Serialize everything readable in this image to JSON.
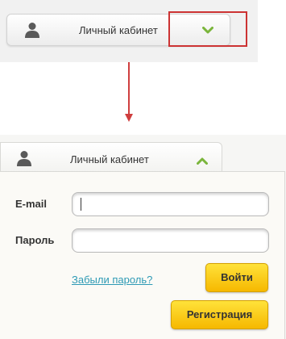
{
  "collapsed_bar": {
    "label": "Личный кабинет"
  },
  "expanded_tab": {
    "label": "Личный кабинет"
  },
  "login_form": {
    "email_label": "E-mail",
    "email_value": "",
    "password_label": "Пароль",
    "password_value": "",
    "forgot_link": "Забыли пароль?",
    "login_button": "Войти",
    "register_button": "Регистрация"
  },
  "icons": {
    "user": "user-icon",
    "chevron_down": "chevron-down-icon",
    "chevron_up": "chevron-up-icon"
  },
  "colors": {
    "chevron": "#7ab53b",
    "highlight": "#cc3333",
    "arrow": "#cf3e3e",
    "button_yellow": "#f6c300",
    "link": "#2e9ab5"
  }
}
